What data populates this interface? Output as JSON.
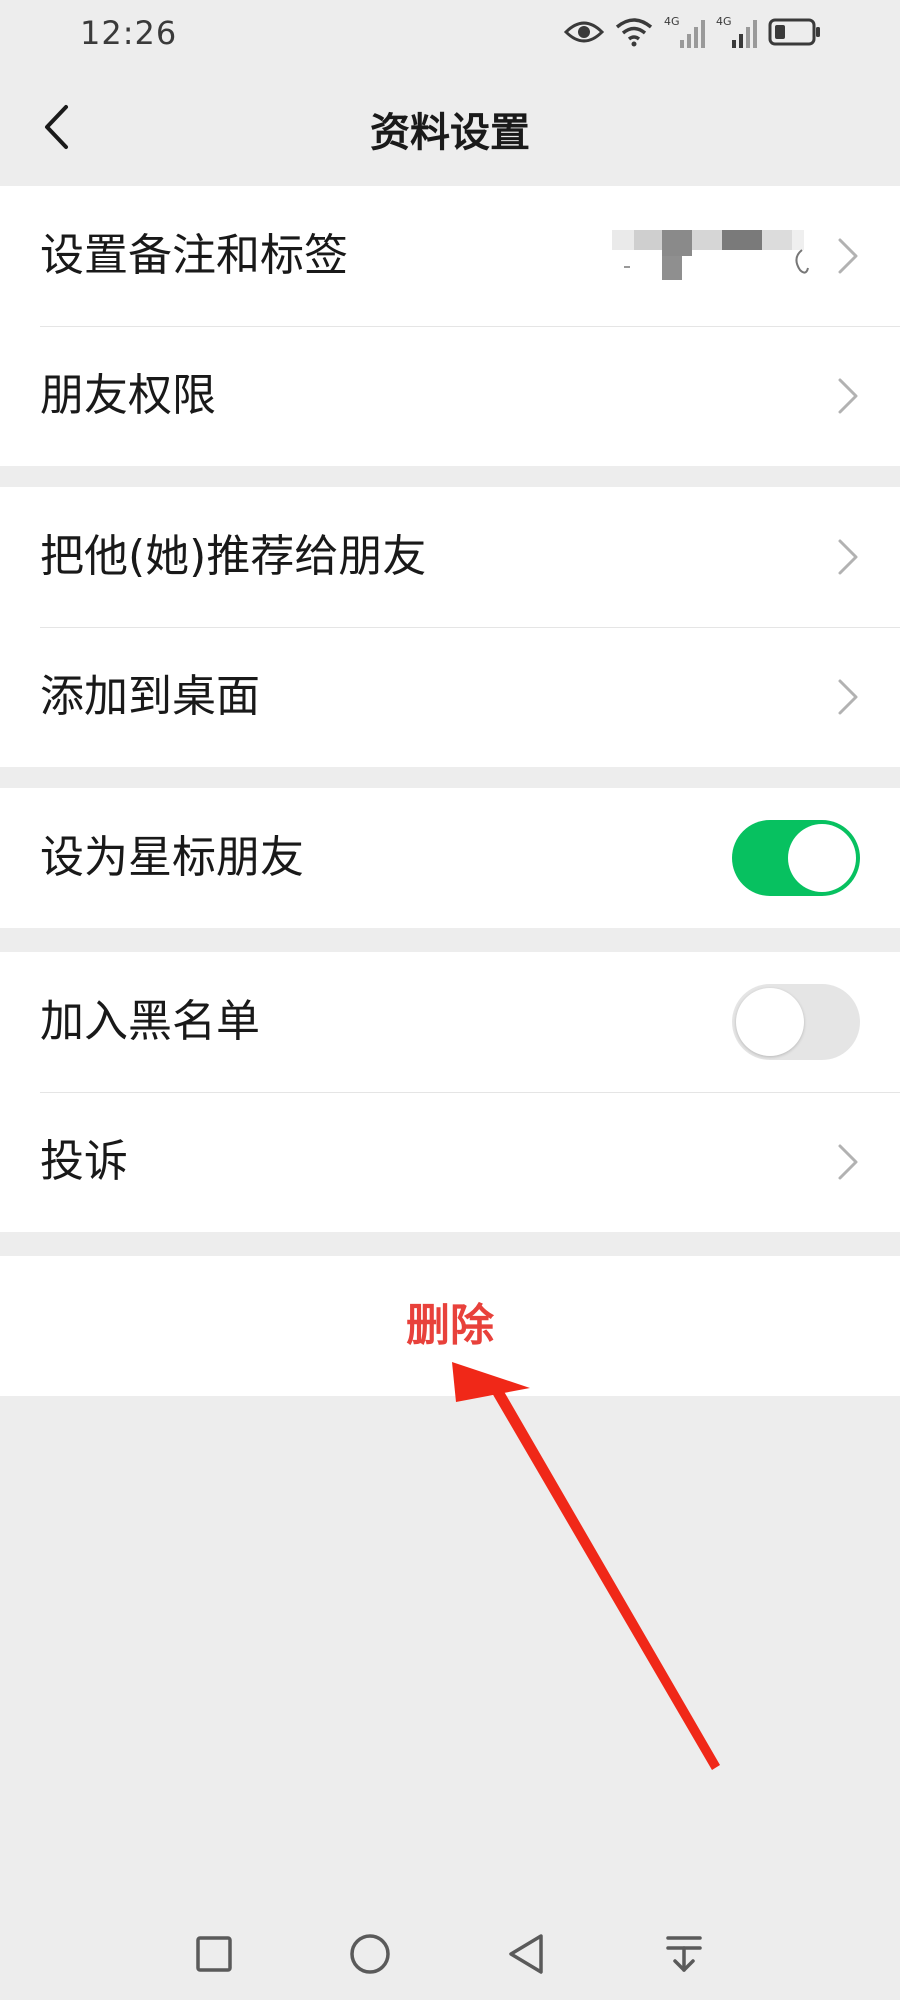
{
  "status_bar": {
    "time": "12:26",
    "icons": [
      "eye-icon",
      "wifi-icon",
      "signal-4g-icon",
      "signal-4g-icon",
      "battery-icon"
    ],
    "network_label": "4G"
  },
  "header": {
    "title": "资料设置",
    "back_icon": "chevron-left-icon"
  },
  "groups": {
    "g1": {
      "remark": {
        "label": "设置备注和标签"
      },
      "permissions": {
        "label": "朋友权限"
      }
    },
    "g2": {
      "recommend": {
        "label": "把他(她)推荐给朋友"
      },
      "desktop": {
        "label": "添加到桌面"
      }
    },
    "g3": {
      "star": {
        "label": "设为星标朋友",
        "enabled": true
      }
    },
    "g4": {
      "blacklist": {
        "label": "加入黑名单",
        "enabled": false
      },
      "complain": {
        "label": "投诉"
      }
    }
  },
  "actions": {
    "delete_label": "删除"
  },
  "colors": {
    "accent_green": "#07c160",
    "danger_red": "#e8413b",
    "annotation_red": "#f02818",
    "background": "#ededed"
  },
  "system_nav": [
    "square-icon",
    "circle-icon",
    "triangle-back-icon",
    "menu-down-icon"
  ]
}
